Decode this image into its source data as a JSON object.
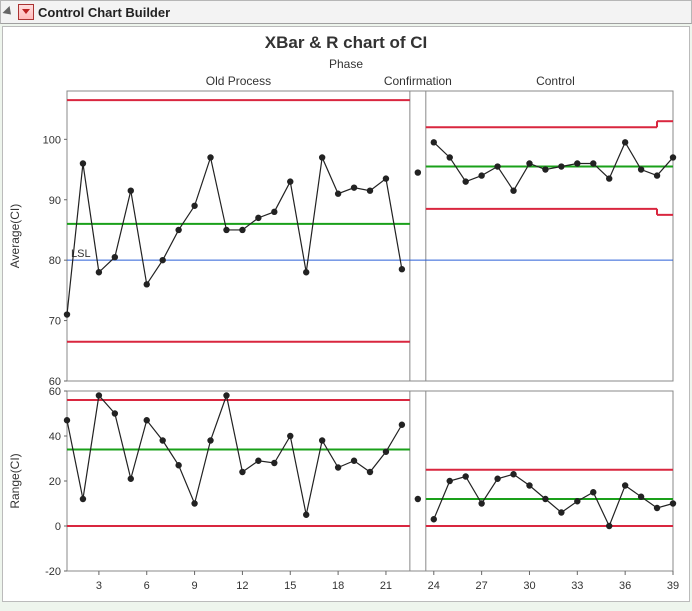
{
  "header": {
    "title": "Control Chart Builder"
  },
  "chart": {
    "title": "XBar & R chart of CI",
    "phase_label": "Phase"
  },
  "phases": [
    "Old Process",
    "Confirmation",
    "Control"
  ],
  "annotations": {
    "lsl": "LSL"
  },
  "axes": {
    "top": {
      "label": "Average(CI)",
      "ticks": [
        60,
        70,
        80,
        90,
        100
      ]
    },
    "bottom": {
      "label": "Range(CI)",
      "ticks": [
        -20,
        0,
        20,
        40,
        60
      ]
    },
    "x": {
      "ticks": [
        3,
        6,
        9,
        12,
        15,
        18,
        21,
        24,
        27,
        30,
        33,
        36,
        39
      ]
    }
  },
  "colors": {
    "limit": "#d9263f",
    "center": "#1aa01a",
    "lsl": "#2a5fd6",
    "data": "#222222"
  },
  "chart_data": [
    {
      "type": "line",
      "title": "Average(CI)",
      "xlabel": "",
      "ylabel": "Average(CI)",
      "ylim": [
        60,
        108
      ],
      "x": [
        1,
        2,
        3,
        4,
        5,
        6,
        7,
        8,
        9,
        10,
        11,
        12,
        13,
        14,
        15,
        16,
        17,
        18,
        19,
        20,
        21,
        22,
        23,
        24,
        25,
        26,
        27,
        28,
        29,
        30,
        31,
        32,
        33,
        34,
        35,
        36,
        37,
        38,
        39
      ],
      "series": [
        {
          "name": "Average(CI)",
          "values": [
            71,
            96,
            78,
            80.5,
            91.5,
            76,
            80,
            85,
            89,
            97,
            85,
            85,
            87,
            88,
            93,
            78,
            97,
            91,
            92,
            91.5,
            93.5,
            78.5,
            94.5,
            99.5,
            97,
            93,
            94,
            95.5,
            91.5,
            96,
            95,
            95.5,
            96,
            96,
            93.5,
            99.5,
            95,
            94,
            97
          ]
        }
      ],
      "phase_breaks": {
        "confirmation_start": 23,
        "control_start": 24
      },
      "control_limits": {
        "Old Process": {
          "center": 86.0,
          "ucl": 106.5,
          "lcl": 66.5
        },
        "Confirmation": {
          "center": 86.0,
          "ucl": 106.5,
          "lcl": 66.5
        },
        "Control": {
          "center": 95.5,
          "ucl": 102.0,
          "lcl": 88.5,
          "ucl_end": 103.0,
          "lcl_end": 87.5
        }
      },
      "spec_limits": {
        "LSL": 80
      }
    },
    {
      "type": "line",
      "title": "Range(CI)",
      "xlabel": "",
      "ylabel": "Range(CI)",
      "ylim": [
        -20,
        60
      ],
      "x": [
        1,
        2,
        3,
        4,
        5,
        6,
        7,
        8,
        9,
        10,
        11,
        12,
        13,
        14,
        15,
        16,
        17,
        18,
        19,
        20,
        21,
        22,
        23,
        24,
        25,
        26,
        27,
        28,
        29,
        30,
        31,
        32,
        33,
        34,
        35,
        36,
        37,
        38,
        39
      ],
      "series": [
        {
          "name": "Range(CI)",
          "values": [
            47,
            12,
            58,
            50,
            21,
            47,
            38,
            27,
            10,
            38,
            58,
            24,
            29,
            28,
            40,
            5,
            38,
            26,
            29,
            24,
            33,
            45,
            12,
            3,
            20,
            22,
            10,
            21,
            23,
            18,
            12,
            6,
            11,
            15,
            0,
            18,
            13,
            8,
            10
          ]
        }
      ],
      "phase_breaks": {
        "confirmation_start": 23,
        "control_start": 24
      },
      "control_limits": {
        "Old Process": {
          "center": 34.0,
          "ucl": 56.0,
          "lcl": 0.0
        },
        "Confirmation": {
          "center": 34.0,
          "ucl": 56.0,
          "lcl": 0.0
        },
        "Control": {
          "center": 12.0,
          "ucl": 25.0,
          "lcl": 0.0
        }
      }
    }
  ]
}
